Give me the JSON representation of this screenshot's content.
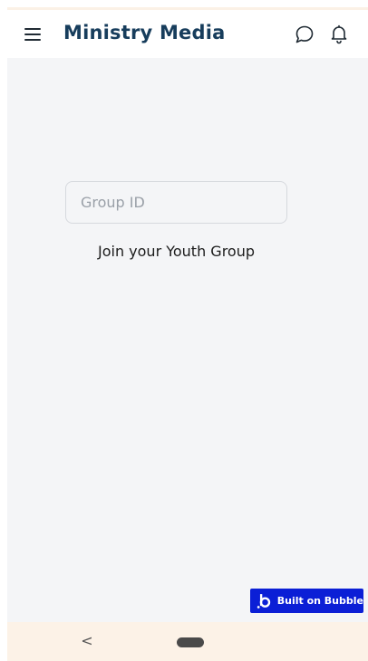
{
  "header": {
    "title": "Ministry Media",
    "menu_icon": "hamburger-menu-icon",
    "chat_icon": "chat-bubble-icon",
    "bell_icon": "notification-bell-icon"
  },
  "form": {
    "group_id_placeholder": "Group ID",
    "group_id_value": "",
    "join_label": "Join your Youth Group"
  },
  "badge": {
    "label": "Built on Bubble",
    "logo_icon": "bubble-logo-icon",
    "color": "#0b1fd6"
  },
  "navbar": {
    "back_glyph": "<",
    "home_icon": "home-pill-icon"
  },
  "colors": {
    "title": "#173d5c",
    "background": "#f4f5f7",
    "header": "#ffffff",
    "navbar": "#fcf2e7"
  }
}
